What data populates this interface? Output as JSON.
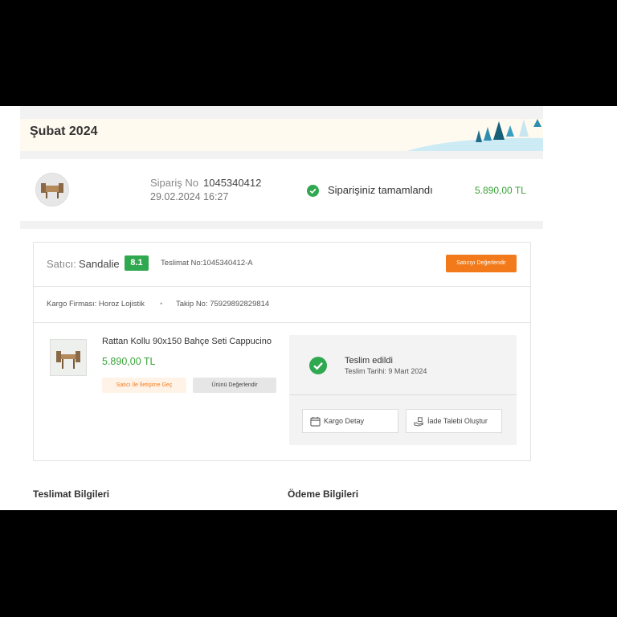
{
  "month_header": {
    "title": "Şubat 2024"
  },
  "order": {
    "no_label": "Sipariş No",
    "no": "1045340412",
    "date": "29.02.2024 16:27",
    "status": "Siparişiniz tamamlandı",
    "total": "5.890,00 TL"
  },
  "seller": {
    "prefix": "Satıcı:",
    "name": "Sandalie",
    "score": "8.1",
    "delivery_no": "Teslimat No:1045340412-A",
    "rate_button": "Satıcıyı Değerlendir"
  },
  "cargo": {
    "firm": "Kargo Firması: Horoz Lojistik",
    "separator": "•",
    "tracking": "Takip No: 75929892829814"
  },
  "product": {
    "name": "Rattan Kollu 90x150 Bahçe Seti Cappucino",
    "price": "5.890,00 TL",
    "contact_button": "Satıcı İle İletişime Geç",
    "rate_button": "Ürünü Değerlendir"
  },
  "delivery_status": {
    "title": "Teslim edildi",
    "date": "Teslim Tarihi: 9 Mart 2024",
    "cargo_detail_button": "Kargo Detay",
    "return_button": "İade Talebi Oluştur"
  },
  "sections": {
    "delivery_info": "Teslimat Bilgileri",
    "payment_info": "Ödeme Bilgileri"
  },
  "colors": {
    "accent_orange": "#f27a1a",
    "success_green": "#2fa84f",
    "price_green": "#3aa33a"
  },
  "icons": {
    "order_status": "check-circle-icon",
    "delivered": "check-circle-icon",
    "cargo_detail": "calendar-icon",
    "return": "return-hand-icon"
  }
}
